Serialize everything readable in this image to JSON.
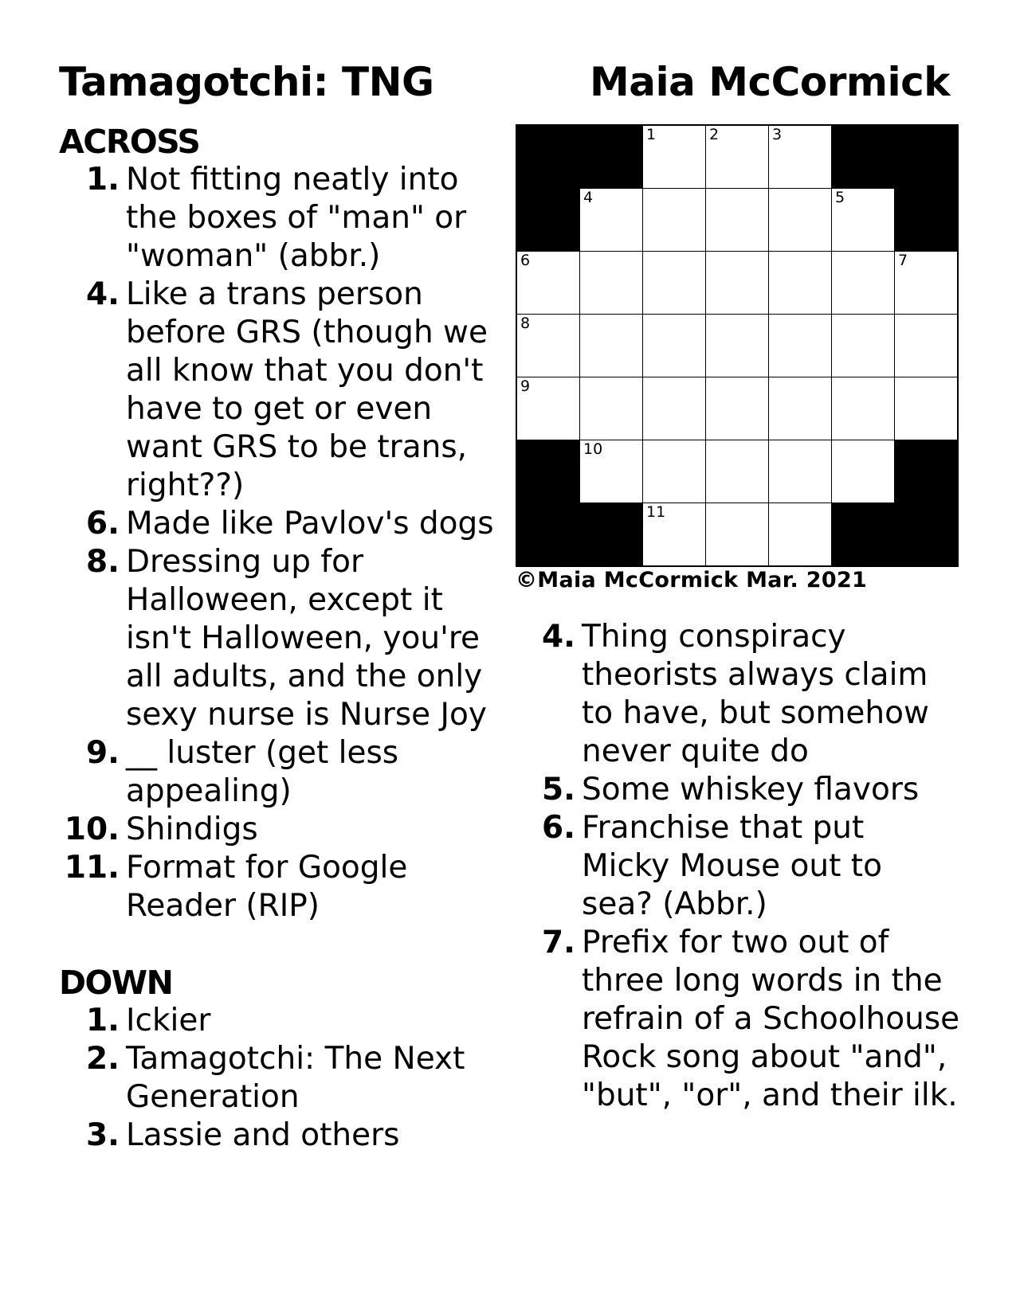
{
  "header": {
    "title": "Tamagotchi: TNG",
    "author": "Maia McCormick"
  },
  "grid": {
    "rows": 7,
    "cols": 7,
    "cells": [
      [
        "#",
        "#",
        "1",
        "2",
        "3",
        "#",
        "#"
      ],
      [
        "#",
        "4",
        "",
        "",
        "",
        "5",
        "#"
      ],
      [
        "6",
        "",
        "",
        "",
        "",
        "",
        "7"
      ],
      [
        "8",
        "",
        "",
        "",
        "",
        "",
        ""
      ],
      [
        "9",
        "",
        "",
        "",
        "",
        "",
        ""
      ],
      [
        "#",
        "10",
        "",
        "",
        "",
        "",
        "#"
      ],
      [
        "#",
        "#",
        "11",
        "",
        "",
        "#",
        "#"
      ]
    ]
  },
  "copyright": "©Maia McCormick Mar. 2021",
  "across": {
    "heading": "ACROSS",
    "clues": [
      {
        "num": "1.",
        "text": "Not fitting neatly into the boxes of \"man\" or \"woman\" (abbr.)"
      },
      {
        "num": "4.",
        "text": "Like a trans person before GRS (though we all know that you don't have to get or even want GRS to be trans, right??)"
      },
      {
        "num": "6.",
        "text": "Made like Pavlov's dogs"
      },
      {
        "num": "8.",
        "text": "Dressing up for Halloween, except it isn't Halloween, you're all adults, and the only sexy nurse is Nurse Joy"
      },
      {
        "num": "9.",
        "text": "__ luster (get less appealing)"
      },
      {
        "num": "10.",
        "text": "Shindigs"
      },
      {
        "num": "11.",
        "text": "Format for Google Reader (RIP)"
      }
    ]
  },
  "down": {
    "heading": "DOWN",
    "clues": [
      {
        "num": "1.",
        "text": "Ickier"
      },
      {
        "num": "2.",
        "text": "Tamagotchi: The Next Generation"
      },
      {
        "num": "3.",
        "text": "Lassie and others"
      },
      {
        "num": "4.",
        "text": "Thing conspiracy theorists always claim to have, but somehow never quite do"
      },
      {
        "num": "5.",
        "text": "Some whiskey flavors"
      },
      {
        "num": "6.",
        "text": "Franchise that put Micky Mouse out to sea? (Abbr.)"
      },
      {
        "num": "7.",
        "text": "Prefix for two out of three long words in the refrain of a Schoolhouse Rock song about \"and\", \"but\", \"or\", and their ilk."
      }
    ]
  }
}
